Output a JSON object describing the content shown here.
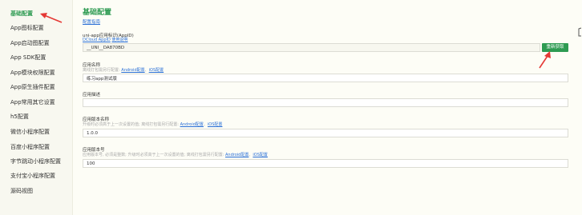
{
  "sidebar": {
    "items": [
      {
        "label": "基础配置",
        "active": true
      },
      {
        "label": "App图标配置"
      },
      {
        "label": "App启动图配置"
      },
      {
        "label": "App SDK配置"
      },
      {
        "label": "App模块权限配置"
      },
      {
        "label": "App原生插件配置"
      },
      {
        "label": "App常用其它设置"
      },
      {
        "label": "h5配置"
      },
      {
        "label": "微信小程序配置"
      },
      {
        "label": "百度小程序配置"
      },
      {
        "label": "字节跳动小程序配置"
      },
      {
        "label": "支付宝小程序配置"
      },
      {
        "label": "源码视图"
      }
    ]
  },
  "main": {
    "title": "基础配置",
    "doc_link": "配置指南",
    "appid": {
      "label": "uni-app应用标识(AppID)",
      "hint_link_1": "DCloud AppID",
      "hint_link_2": "使用说明",
      "value": "__UNI__DA870BD",
      "regen_button": "重新获取"
    },
    "app_name": {
      "label": "应用名称",
      "hint_prefix": "离线打包需另行配置:",
      "link_android": "Android配置",
      "separator": "、",
      "link_ios": "iOS配置",
      "value": "练习app测试版"
    },
    "app_desc": {
      "label": "应用描述",
      "value": ""
    },
    "version_name": {
      "label": "应用版本名称",
      "hint_prefix": "升级时必须高于上一次设置的值; 离线打包需另行配置:",
      "link_android": "Android配置",
      "separator": "、",
      "link_ios": "iOS配置",
      "value": "1.0.0"
    },
    "version_code": {
      "label": "应用版本号",
      "hint_prefix": "应用版本号, 必须是整数; 升级时必须高于上一次设置的值; 离线打包需另行配置:",
      "link_android": "Android配置",
      "separator": "、",
      "link_ios": "iOS配置",
      "value": "100"
    }
  },
  "colors": {
    "accent": "#2e9b52",
    "link": "#2a6fd6",
    "annotation": "#e53935"
  }
}
